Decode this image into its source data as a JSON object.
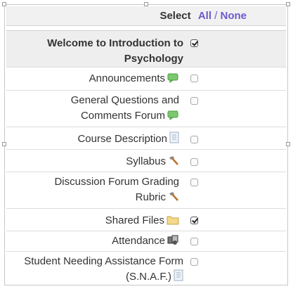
{
  "select_bar": {
    "label": "Select",
    "all": "All",
    "separator": "/",
    "none": "None"
  },
  "header": {
    "title_line1": "Welcome to Introduction to",
    "title_line2": "Psychology",
    "checked": true
  },
  "items": [
    {
      "line1": "Announcements",
      "line2": "",
      "icon": "speech-bubble-icon",
      "checked": false
    },
    {
      "line1": "General Questions and",
      "line2": "Comments Forum",
      "icon": "speech-bubble-icon",
      "checked": false
    },
    {
      "line1": "Course Description",
      "line2": "",
      "icon": "document-icon",
      "checked": false
    },
    {
      "line1": "Syllabus",
      "line2": "",
      "icon": "hammer-icon",
      "checked": false
    },
    {
      "line1": "Discussion Forum Grading",
      "line2": "Rubric",
      "icon": "hammer-icon",
      "checked": false
    },
    {
      "line1": "Shared Files",
      "line2": "",
      "icon": "folder-icon",
      "checked": true
    },
    {
      "line1": "Attendance",
      "line2": "",
      "icon": "attendance-icon",
      "checked": false
    },
    {
      "line1": "Student Needing Assistance Form",
      "line2": "(S.N.A.F.)",
      "icon": "document-icon",
      "checked": false
    }
  ],
  "colors": {
    "link": "#6a5acd",
    "header_bg": "#eeeeee",
    "select_bar_bg": "#f1f1f1"
  }
}
